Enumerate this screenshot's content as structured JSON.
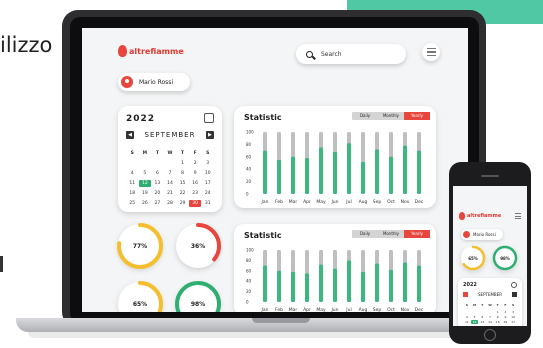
{
  "background": {
    "word": "ilizzo",
    "accent": "#4fc8a3"
  },
  "app": {
    "logo": "altrefiamme",
    "search_placeholder": "Search",
    "user_name": "Mario Rossi"
  },
  "calendar": {
    "year": "2022",
    "month": "SEPTEMBER",
    "weekdays": [
      "S",
      "M",
      "T",
      "W",
      "T",
      "F",
      "S"
    ],
    "days": [
      "",
      "",
      "",
      "",
      "1",
      "2",
      "3",
      "4",
      "5",
      "6",
      "7",
      "8",
      "9",
      "10",
      "11",
      "12",
      "13",
      "14",
      "15",
      "16",
      "17",
      "18",
      "19",
      "20",
      "21",
      "22",
      "23",
      "24",
      "25",
      "26",
      "27",
      "28",
      "29",
      "30",
      "31"
    ],
    "today": "12",
    "selected": "30"
  },
  "statistic_1": {
    "title": "Statistic",
    "toggle": [
      "Daily",
      "Monthly",
      "Yearly"
    ],
    "active": "Yearly"
  },
  "statistic_2": {
    "title": "Statistic",
    "toggle": [
      "Daily",
      "Monthly",
      "Yearly"
    ],
    "active": "Yearly"
  },
  "chart_data": [
    {
      "type": "bar",
      "title": "Statistic",
      "categories": [
        "Jan",
        "Feb",
        "Mar",
        "Apr",
        "May",
        "Jun",
        "Jul",
        "Aug",
        "Sep",
        "Oct",
        "Nov",
        "Dec"
      ],
      "ylim": [
        0,
        100
      ],
      "yticks": [
        0,
        20,
        40,
        60,
        80,
        100
      ],
      "series": [
        {
          "values": [
            70,
            55,
            60,
            58,
            75,
            68,
            82,
            52,
            72,
            60,
            78,
            70
          ]
        }
      ]
    },
    {
      "type": "bar",
      "title": "Statistic",
      "categories": [
        "Jan",
        "Feb",
        "Mar",
        "Apr",
        "May",
        "Jun",
        "Jul",
        "Aug",
        "Sep",
        "Oct",
        "Nov",
        "Dec"
      ],
      "ylim": [
        0,
        100
      ],
      "yticks": [
        0,
        20,
        40,
        60,
        80,
        100
      ],
      "series": [
        {
          "values": [
            70,
            60,
            58,
            55,
            72,
            64,
            80,
            58,
            74,
            62,
            76,
            70
          ]
        }
      ]
    }
  ],
  "rings": [
    {
      "label": "77%",
      "value": 77,
      "color": "#f5be2e"
    },
    {
      "label": "36%",
      "value": 36,
      "color": "#e8463c"
    },
    {
      "label": "65%",
      "value": 65,
      "color": "#f5be2e"
    },
    {
      "label": "98%",
      "value": 98,
      "color": "#2fae72"
    }
  ],
  "phone": {
    "logo": "altrefiamme",
    "user_name": "Mario Rossi",
    "year": "2022",
    "month": "SEPTEMBER",
    "rings": [
      {
        "label": "65%",
        "value": 65,
        "color": "#f5be2e"
      },
      {
        "label": "98%",
        "value": 98,
        "color": "#2fae72"
      }
    ]
  },
  "colors": {
    "bar_fg": "#3cb77f",
    "bar_bg": "#bfbfbf",
    "accent": "#e8463c"
  }
}
